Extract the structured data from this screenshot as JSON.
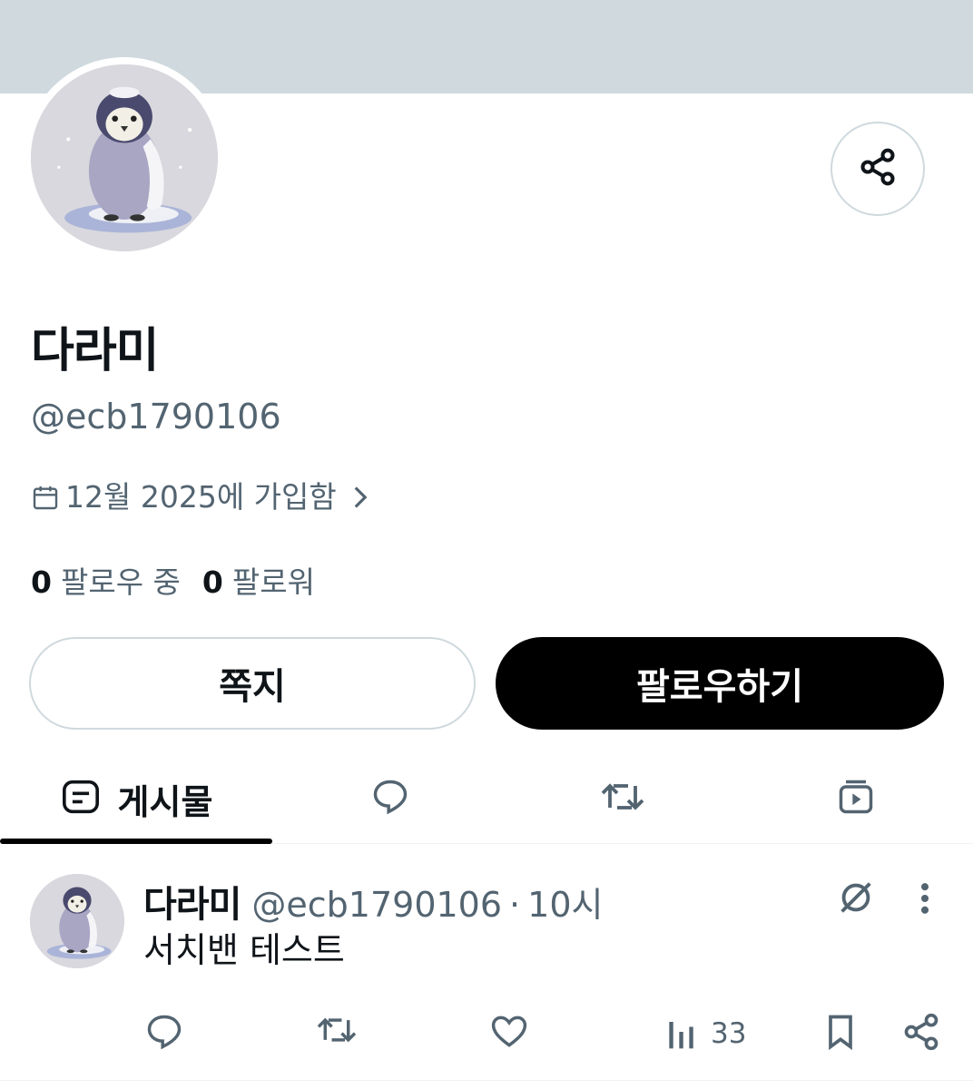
{
  "profile": {
    "display_name": "다라미",
    "handle": "@ecb1790106",
    "joined": "12월 2025에 가입함",
    "following_count": "0",
    "following_label": "팔로우 중",
    "followers_count": "0",
    "followers_label": "팔로워"
  },
  "actions": {
    "message_label": "쪽지",
    "follow_label": "팔로우하기"
  },
  "tabs": [
    {
      "label": "게시물",
      "icon": "posts-icon",
      "active": true
    },
    {
      "label": "",
      "icon": "replies-icon",
      "active": false
    },
    {
      "label": "",
      "icon": "reposts-icon",
      "active": false
    },
    {
      "label": "",
      "icon": "media-icon",
      "active": false
    }
  ],
  "post": {
    "author_name": "다라미",
    "author_handle": "@ecb1790106",
    "separator": "·",
    "time": "10시",
    "text": "서치밴 테스트",
    "views": "33"
  },
  "colors": {
    "banner": "#cfd9de",
    "text_primary": "#0f1419",
    "text_secondary": "#536471",
    "border": "#cfd9de",
    "follow_button": "#000000"
  }
}
